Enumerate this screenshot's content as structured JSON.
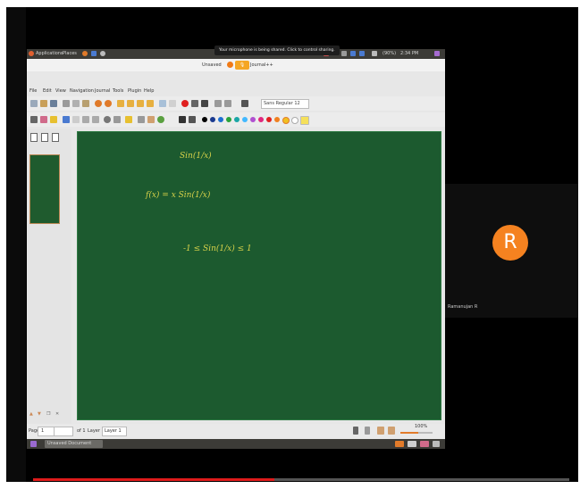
{
  "system_bar": {
    "applications": "Applications",
    "places": "Places",
    "battery_pct": "(90%)",
    "clock": "2:34 PM"
  },
  "window": {
    "title_left": "Unsaved",
    "title_right": "Journal++"
  },
  "tooltip": "Your microphone is being shared. Click to control sharing.",
  "menu": [
    "File",
    "Edit",
    "View",
    "Navigation",
    "Journal",
    "Tools",
    "Plugin",
    "Help"
  ],
  "toolbar": {
    "font": "Sans Regular 12",
    "icons": [
      "new-icon",
      "open-icon",
      "save-icon",
      "cut-icon",
      "copy-icon",
      "paste-icon",
      "undo-icon",
      "redo-icon",
      "first-page-icon",
      "prev-page-icon",
      "next-page-icon",
      "last-page-icon",
      "add-page-icon",
      "delete-page-icon",
      "record-icon",
      "pause-icon",
      "stop-icon"
    ],
    "colors": [
      "#000000",
      "#1a3a8f",
      "#1f6fd1",
      "#2aa23a",
      "#19a6a6",
      "#42b8ff",
      "#b050d0",
      "#e0287d",
      "#e02020",
      "#f08020",
      "#f0c020",
      "#ffffff"
    ]
  },
  "board": {
    "eq1": "Sin(1/x)",
    "eq2": "f(x) = x Sin(1/x)",
    "eq3": "-1 ≤ Sin(1/x) ≤ 1"
  },
  "status": {
    "page_label": "Page",
    "page_value": "1",
    "of_label": "of 1",
    "layer_label": "Layer",
    "layer_value": "Layer 1",
    "zoom": "100%",
    "zoom_fraction": 0.55
  },
  "taskbar": {
    "item": "Unsaved Document"
  },
  "participant": {
    "initial": "R",
    "name": "Ramanujan R"
  },
  "video": {
    "progress_fraction": 0.45
  }
}
